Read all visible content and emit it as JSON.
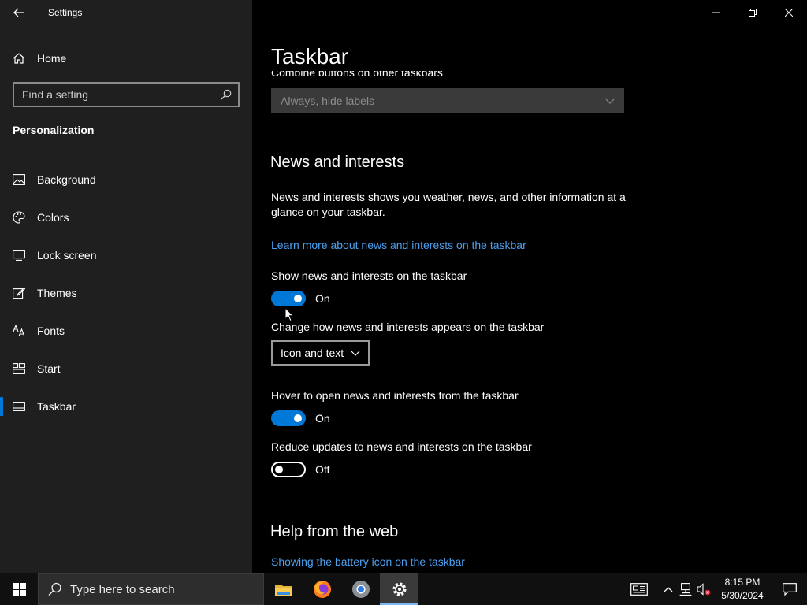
{
  "window": {
    "app_title": "Settings"
  },
  "sidebar": {
    "home_label": "Home",
    "search_placeholder": "Find a setting",
    "section_title": "Personalization",
    "items": [
      {
        "label": "Background",
        "icon": "picture-icon"
      },
      {
        "label": "Colors",
        "icon": "palette-icon"
      },
      {
        "label": "Lock screen",
        "icon": "lock-screen-icon"
      },
      {
        "label": "Themes",
        "icon": "brush-icon"
      },
      {
        "label": "Fonts",
        "icon": "font-icon"
      },
      {
        "label": "Start",
        "icon": "start-layout-icon"
      },
      {
        "label": "Taskbar",
        "icon": "taskbar-icon",
        "active": true
      }
    ]
  },
  "main": {
    "page_title": "Taskbar",
    "combine_label_clipped": "Combine buttons on other taskbars",
    "combine_value": "Always, hide labels",
    "news": {
      "heading": "News and interests",
      "description": "News and interests shows you weather, news, and other information at a glance on your taskbar.",
      "learn_more_link": "Learn more about news and interests on the taskbar",
      "show_label": "Show news and interests on the taskbar",
      "show_state": "On",
      "appear_label": "Change how news and interests appears on the taskbar",
      "appear_value": "Icon and text",
      "hover_label": "Hover to open news and interests from the taskbar",
      "hover_state": "On",
      "reduce_label": "Reduce updates to news and interests on the taskbar",
      "reduce_state": "Off"
    },
    "help": {
      "heading": "Help from the web",
      "link": "Showing the battery icon on the taskbar"
    }
  },
  "taskbar": {
    "search_placeholder": "Type here to search",
    "apps": [
      "file-explorer-icon",
      "firefox-icon",
      "chrome-icon",
      "settings-gear-icon"
    ],
    "time": "8:15 PM",
    "date": "5/30/2024"
  },
  "colors": {
    "accent": "#0078d7",
    "link": "#4ba0f0",
    "sidebar_bg": "#1f1f1f",
    "main_bg": "#000000"
  }
}
